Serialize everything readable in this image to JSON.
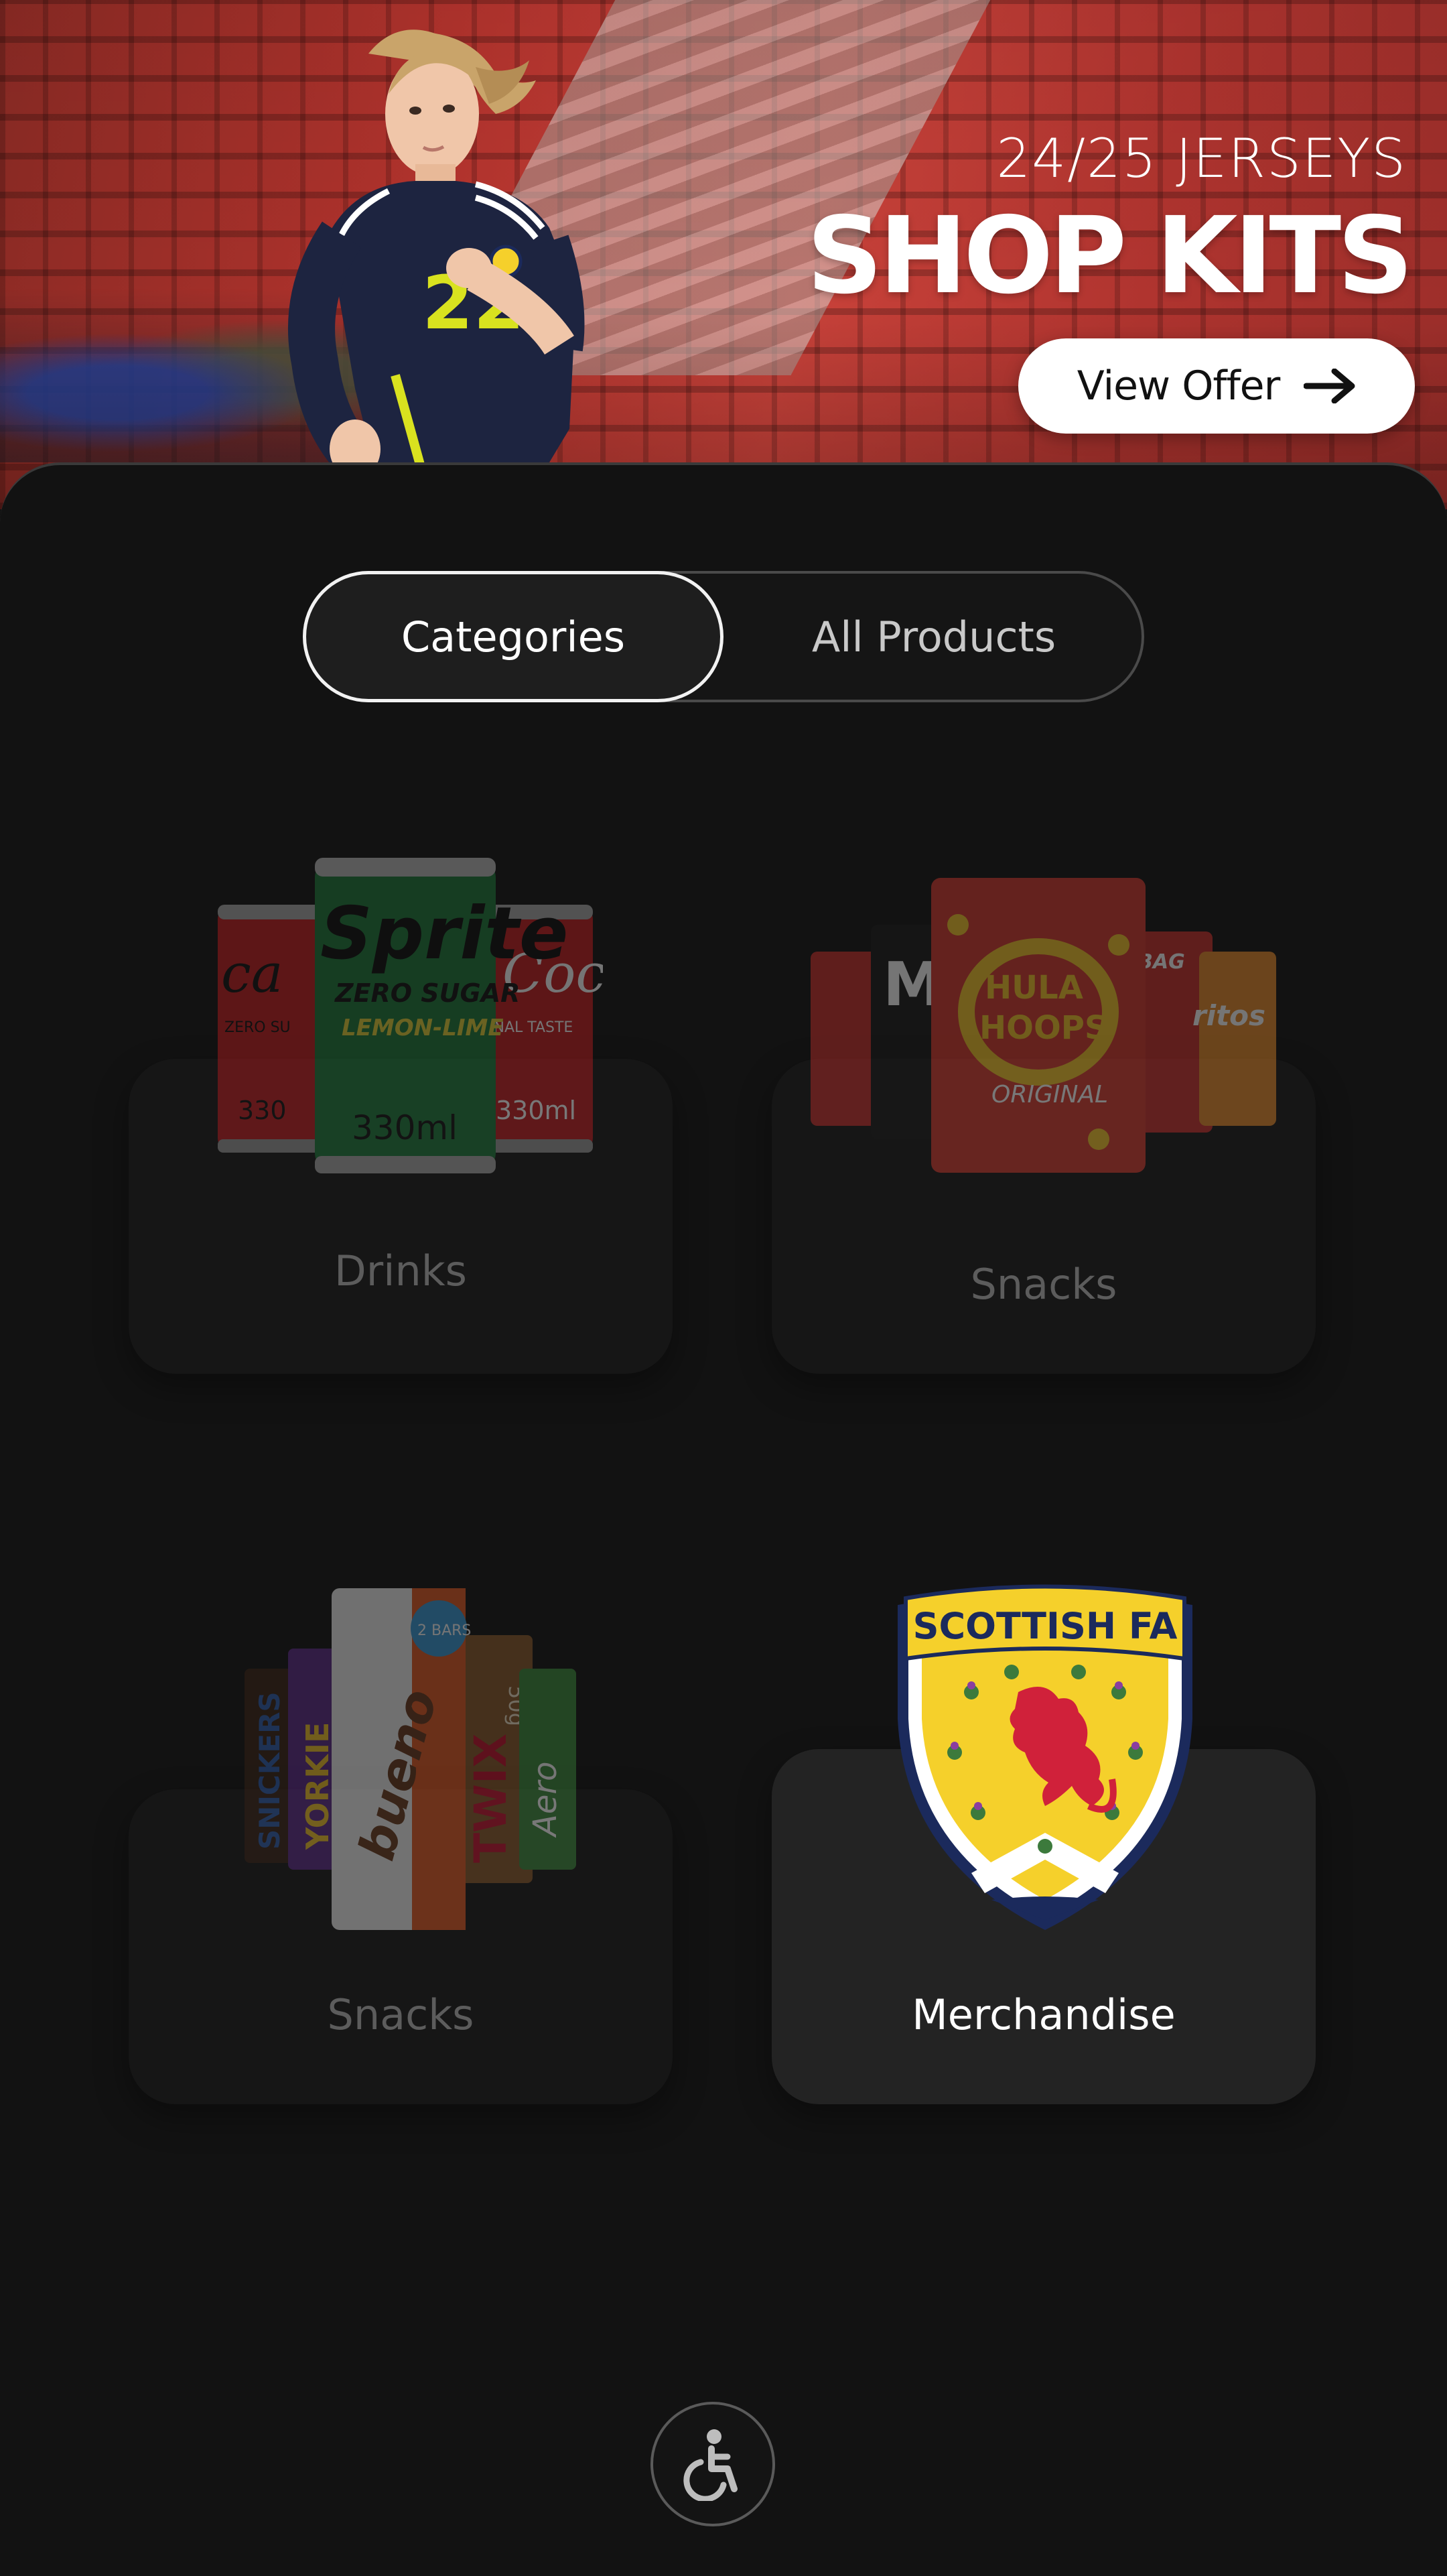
{
  "hero": {
    "subtitle": "24/25 JERSEYS",
    "title": "SHOP KITS",
    "offer_button": {
      "label": "View Offer",
      "icon": "arrow-right-icon"
    }
  },
  "tabs": {
    "categories_label": "Categories",
    "all_products_label": "All Products",
    "active": "Categories"
  },
  "categories": [
    {
      "label": "Drinks",
      "state": "dimmed"
    },
    {
      "label": "Snacks",
      "state": "dimmed"
    },
    {
      "label": "Snacks",
      "state": "dimmed"
    },
    {
      "label": "Merchandise",
      "state": "selected"
    }
  ],
  "product_art": {
    "drinks": {
      "center_brand": "Sprite",
      "center_line1": "ZERO SUGAR",
      "center_line2": "LEMON-LIME",
      "volume": "330ml",
      "side_line": "ZERO SU",
      "side_line2": "INAL TASTE"
    },
    "snacks1": {
      "brand": "HULA HOOPS",
      "variant": "ORIGINAL",
      "side": "ritos",
      "tag": "BAG"
    },
    "snacks2": {
      "bars": [
        "SNICKERS",
        "YORKIE",
        "bueno",
        "TWIX",
        "Aero"
      ],
      "badge": "2 BARS",
      "weight": "50g"
    },
    "crest": {
      "text": "SCOTTISH FA"
    }
  },
  "accessibility": {
    "icon": "accessibility-icon"
  },
  "colors": {
    "background": "#121212",
    "hero_red": "#b3332d",
    "active_border": "#f2f2f2",
    "crest_yellow": "#f5d02b",
    "crest_navy": "#1b2a5c",
    "lion_red": "#d0213a"
  }
}
